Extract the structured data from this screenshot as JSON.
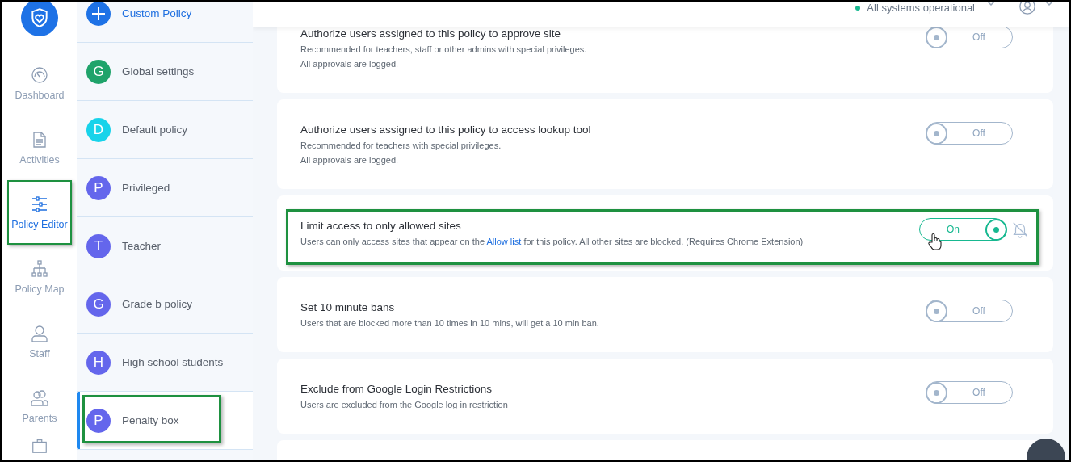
{
  "nav": [
    {
      "label": "Dashboard",
      "selected": false,
      "highlighted": false
    },
    {
      "label": "Activities",
      "selected": false,
      "highlighted": false
    },
    {
      "label": "Policy Editor",
      "selected": true,
      "highlighted": true
    },
    {
      "label": "Policy Map",
      "selected": false,
      "highlighted": false
    },
    {
      "label": "Staff",
      "selected": false,
      "highlighted": false
    },
    {
      "label": "Parents",
      "selected": false,
      "highlighted": false
    }
  ],
  "policies": [
    {
      "kind": "add",
      "label": "Custom Policy",
      "selected": false,
      "highlighted": false
    },
    {
      "kind": "avatar",
      "initial": "G",
      "color": "#1fa36a",
      "label": "Global settings",
      "selected": false,
      "highlighted": false
    },
    {
      "kind": "avatar",
      "initial": "D",
      "color": "#17d3ea",
      "label": "Default policy",
      "selected": false,
      "highlighted": false
    },
    {
      "kind": "avatar",
      "initial": "P",
      "color": "#6466ec",
      "label": "Privileged",
      "selected": false,
      "highlighted": false
    },
    {
      "kind": "avatar",
      "initial": "T",
      "color": "#6466ec",
      "label": "Teacher",
      "selected": false,
      "highlighted": false
    },
    {
      "kind": "avatar",
      "initial": "G",
      "color": "#6466ec",
      "label": "Grade b policy",
      "selected": false,
      "highlighted": false
    },
    {
      "kind": "avatar",
      "initial": "H",
      "color": "#6466ec",
      "label": "High school students",
      "selected": false,
      "highlighted": false
    },
    {
      "kind": "avatar",
      "initial": "P",
      "color": "#6466ec",
      "label": "Penalty box",
      "selected": true,
      "highlighted": true
    }
  ],
  "header": {
    "status": "All systems operational"
  },
  "settings": [
    {
      "title": "Authorize users assigned to this policy to approve site",
      "lines": [
        [
          {
            "text": "Recommended for teachers, staff or other admins with special privileges."
          }
        ],
        [
          {
            "text": "All approvals are logged."
          }
        ]
      ],
      "toggle": {
        "on": false,
        "label": "Off"
      },
      "highlighted": false,
      "bell_muted": false,
      "pointer": false
    },
    {
      "title": "Authorize users assigned to this policy to access lookup tool",
      "lines": [
        [
          {
            "text": "Recommended for teachers with special privileges."
          }
        ],
        [
          {
            "text": "All approvals are logged."
          }
        ]
      ],
      "toggle": {
        "on": false,
        "label": "Off"
      },
      "highlighted": false,
      "bell_muted": false,
      "pointer": false
    },
    {
      "title": "Limit access to only allowed sites",
      "lines": [
        [
          {
            "text": "Users can only access sites that appear on the "
          },
          {
            "text": "Allow list",
            "kind": "link"
          },
          {
            "text": " for this policy. All other sites are blocked. (Requires Chrome Extension)"
          }
        ]
      ],
      "toggle": {
        "on": true,
        "label": "On"
      },
      "highlighted": true,
      "bell_muted": true,
      "pointer": true
    },
    {
      "title": "Set 10 minute bans",
      "lines": [
        [
          {
            "text": "Users that are blocked more than 10 times in 10 mins, will get a 10 min ban."
          }
        ]
      ],
      "toggle": {
        "on": false,
        "label": "Off"
      },
      "highlighted": false,
      "bell_muted": false,
      "pointer": false
    },
    {
      "title": "Exclude from Google Login Restrictions",
      "lines": [
        [
          {
            "text": "Users are excluded from the Google log in restriction"
          }
        ]
      ],
      "toggle": {
        "on": false,
        "label": "Off"
      },
      "highlighted": false,
      "bell_muted": false,
      "pointer": false
    }
  ]
}
